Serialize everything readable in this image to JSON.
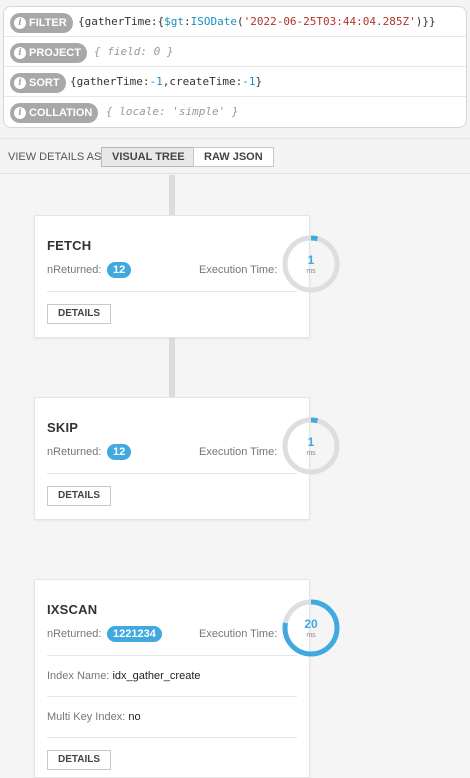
{
  "query": {
    "filter": {
      "label": "FILTER",
      "value": "{gatherTime:{$gt:ISODate('2022-06-25T03:44:04.285Z')}}"
    },
    "project": {
      "label": "PROJECT",
      "placeholder": "{ field: 0 }"
    },
    "sort": {
      "label": "SORT",
      "value": "{gatherTime:-1,createTime:-1}"
    },
    "collation": {
      "label": "COLLATION",
      "placeholder": "{ locale: 'simple' }"
    }
  },
  "view": {
    "label": "VIEW DETAILS AS",
    "visual_tree": "VISUAL TREE",
    "raw_json": "RAW JSON"
  },
  "stages": [
    {
      "title": "FETCH",
      "nreturned_label": "nReturned:",
      "nreturned": "12",
      "exec_label": "Execution Time:",
      "exec_time": "1",
      "exec_unit": "ms",
      "gauge_fraction": 0.04,
      "details": "DETAILS"
    },
    {
      "title": "SKIP",
      "nreturned_label": "nReturned:",
      "nreturned": "12",
      "exec_label": "Execution Time:",
      "exec_time": "1",
      "exec_unit": "ms",
      "gauge_fraction": 0.04,
      "details": "DETAILS"
    },
    {
      "title": "IXSCAN",
      "nreturned_label": "nReturned:",
      "nreturned": "1221234",
      "exec_label": "Execution Time:",
      "exec_time": "20",
      "exec_unit": "ms",
      "gauge_fraction": 0.78,
      "details": "DETAILS",
      "index_name_label": "Index Name:",
      "index_name": "idx_gather_create",
      "multikey_label": "Multi Key Index:",
      "multikey": "no"
    }
  ],
  "colors": {
    "accent": "#3fa9e0",
    "gauge_track": "#dedede",
    "badge": "#3fa9e0"
  }
}
